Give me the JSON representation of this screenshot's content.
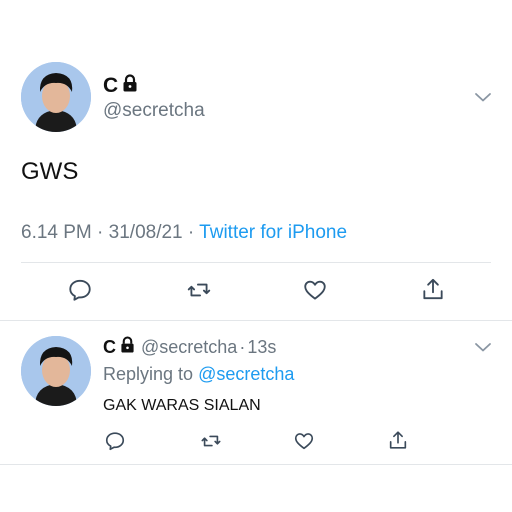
{
  "main_tweet": {
    "author_name": "C",
    "handle": "@secretcha",
    "text": "GWS",
    "time": "6.14 PM",
    "sep1": "·",
    "date": "31/08/21",
    "sep2": "·",
    "source": "Twitter for iPhone"
  },
  "reply_tweet": {
    "author_name": "C",
    "handle": "@secretcha",
    "sep": "·",
    "age": "13s",
    "replying_prefix": "Replying to",
    "replying_to": "@secretcha",
    "text": "GAK WARAS SIALAN"
  },
  "colors": {
    "accent": "#1d9bf0",
    "muted": "#6b7680",
    "icon": "#3b4a5a"
  },
  "icons": [
    "reply-icon",
    "retweet-icon",
    "like-icon",
    "share-icon",
    "lock-icon",
    "chevron-down-icon"
  ]
}
